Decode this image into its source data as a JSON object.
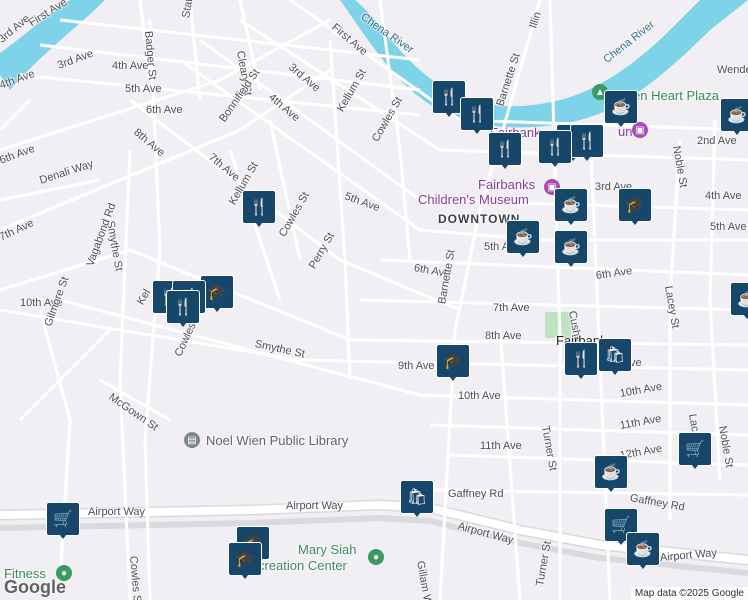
{
  "map": {
    "attribution": "Map data ©2025 Google",
    "logo_text": "Google",
    "district_label": "DOWNTOWN",
    "colors": {
      "road": "#ffffff",
      "water": "#7fd3e8",
      "park": "#bfe3c0",
      "marker": "#17466b",
      "poi_purple": "#a54cb8",
      "poi_green": "#3a9a63",
      "poi_gray": "#7d858c"
    }
  },
  "water": {
    "chena_river": "Chena River",
    "chena_river_2": "Chena River"
  },
  "streets": {
    "first_ave": "First Ave",
    "third_ave_w": "3rd Ave",
    "fourth_ave_w": "4th Ave",
    "fifth_ave_w": "5th Ave",
    "sixth_ave_w": "6th Ave",
    "seventh_ave_w": "7th Ave",
    "eighth_ave_w": "8th Ave",
    "denali_way": "Denali Way",
    "badger_st": "Badger St",
    "state_st": "State St",
    "cleary_st": "Cleary St",
    "bonnifield_st": "Bonnifield St",
    "first_ave_n": "First Ave",
    "third_ave_n": "3rd Ave",
    "fourth_ave_n": "4th Ave",
    "kellum_st_n": "Kellum St",
    "cowles_st_n": "Cowles St",
    "barnette_st_n": "Barnette St",
    "illinois": "Illin",
    "fifth_ave_c": "5th Ave",
    "sixth_ave_c": "6th Ave",
    "seventh_ave_c": "7th Ave",
    "kellum_st": "Kellum St",
    "cowles_st": "Cowles St",
    "perry_st": "Perry St",
    "smythe_st": "Smythe St",
    "vagabond_rd": "Vagabond Rd",
    "tenth_ave_w": "10th Ave",
    "gilmore_st": "Gilmore St",
    "kellum_st_s": "Kel",
    "cowles_st_s": "Cowles St",
    "mcgown_st": "McGown St",
    "smythe_st_s": "Smythe St",
    "ninth_ave": "9th Ave",
    "eighth_ave": "8th Ave",
    "seventh_ave": "7th Ave",
    "barnette_st": "Barnette St",
    "fifth_ave_e": "5th A",
    "sixth_ave_e": "6th Ave",
    "cushman_st": "Cushman St",
    "tenth_ave": "10th Ave",
    "tenth_ave_e": "10th Ave",
    "eleventh_ave": "11th Ave",
    "eleventh_ave_e": "11th Ave",
    "twelfth_ave": "12th Ave",
    "turner_st": "Turner St",
    "gaffney_rd": "Gaffney Rd",
    "gaffney_rd_e": "Gaffney Rd",
    "airport_way_w": "Airport Way",
    "airport_way": "Airport Way",
    "airport_way_e": "Airport Way",
    "airport_way_c": "Airport Way",
    "cowles_st_s2": "Cowles St",
    "gillam_way": "Gillam Way",
    "turner_st_s": "Turner St",
    "noble_st": "Noble St",
    "noble_st_s": "Noble St",
    "lacey_st": "Lacey St",
    "lacey_st_s": "Lacey St",
    "wendell": "Wende",
    "second_ave_e": "2nd Ave",
    "third_ave_e": "3rd Ave",
    "fourth_ave_e": "4th Ave",
    "fifth_ave_far": "5th Ave",
    "sixth_ave_far": "6th Ave",
    "fifth_ave_nw": "5th Ave",
    "fourth_ave_nw": "4th Ave",
    "third_ave_nw": "3rd Ave",
    "sixth_ave_nw": "6th Ave",
    "tenth_ave_c": "10th Ave"
  },
  "pois": {
    "golden_heart": "Golden Heart Plaza",
    "golden_heart_partial": "en Heart Plaza",
    "fairbanks_museum": "Fairbanks",
    "childrens_museum_1": "Fairbanks",
    "childrens_museum_2": "Children's Museum",
    "library": "Noel Wien Public Library",
    "rec_center_1": "Mary Siah",
    "rec_center_2": "creation Center",
    "fitness": "Fitness",
    "fairbanks_partial": "Fairbank",
    "ave_partial": "ve",
    "mun_partial": "un"
  }
}
